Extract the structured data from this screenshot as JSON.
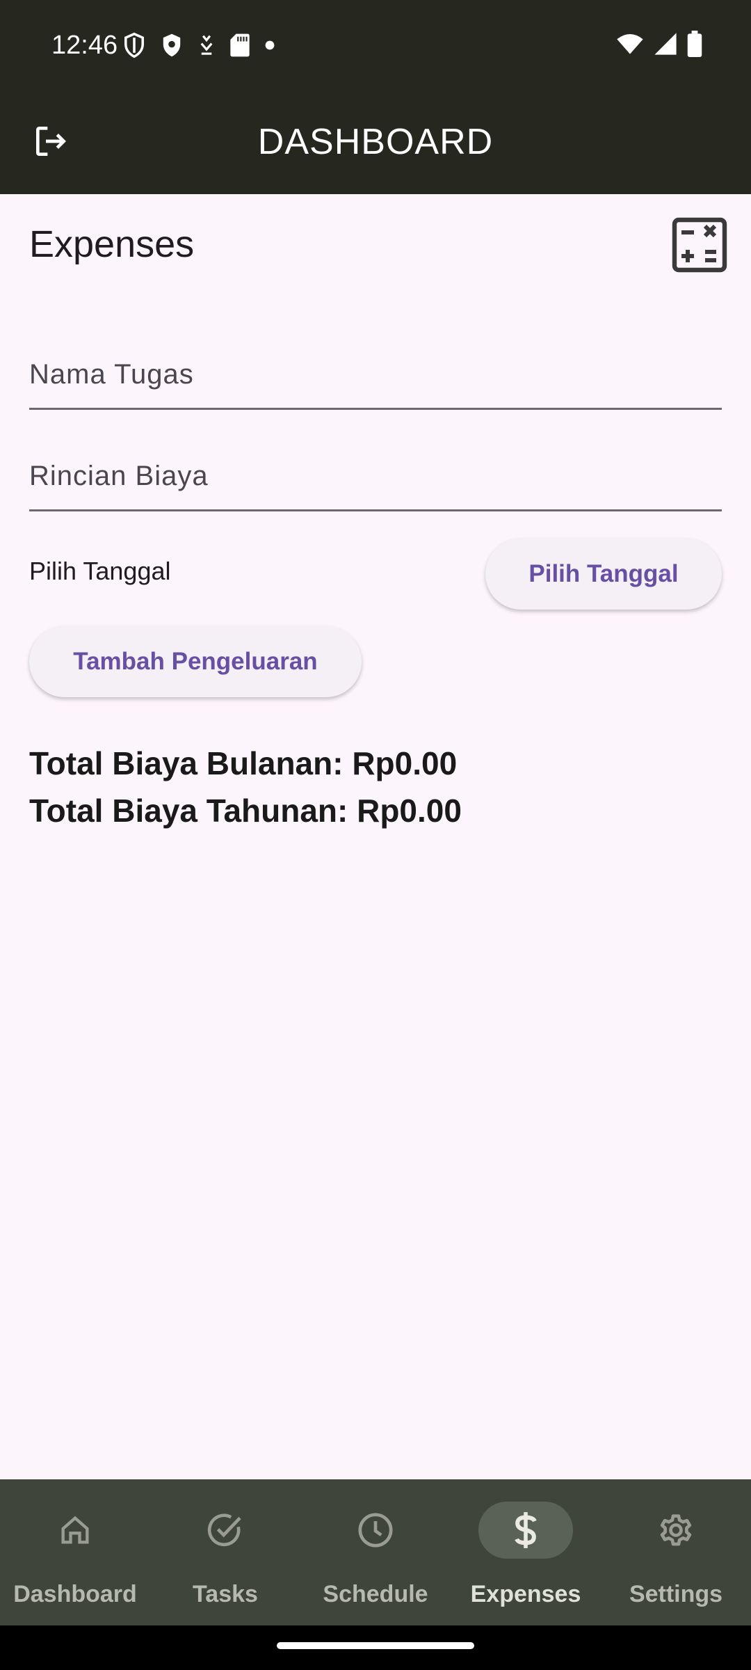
{
  "status_bar": {
    "time": "12:46"
  },
  "app_bar": {
    "title": "DASHBOARD",
    "logout_icon": "logout-icon"
  },
  "expenses": {
    "heading": "Expenses",
    "calculator_icon": "calculator-icon",
    "task_name_placeholder": "Nama Tugas",
    "cost_detail_placeholder": "Rincian Biaya",
    "date_label": "Pilih Tanggal",
    "pick_date_button": "Pilih Tanggal",
    "add_expense_button": "Tambah Pengeluaran",
    "monthly_total": "Total Biaya Bulanan: Rp0.00",
    "yearly_total": "Total Biaya Tahunan: Rp0.00"
  },
  "bottom_nav": {
    "items": [
      {
        "label": "Dashboard",
        "icon": "home-icon"
      },
      {
        "label": "Tasks",
        "icon": "check-circle-icon"
      },
      {
        "label": "Schedule",
        "icon": "clock-icon"
      },
      {
        "label": "Expenses",
        "icon": "dollar-icon",
        "active": true
      },
      {
        "label": "Settings",
        "icon": "gear-icon"
      }
    ]
  },
  "colors": {
    "app_bar_bg": "#26271e",
    "page_bg": "#fcf5fb",
    "accent": "#6750a4",
    "nav_bg": "#3f4639"
  }
}
